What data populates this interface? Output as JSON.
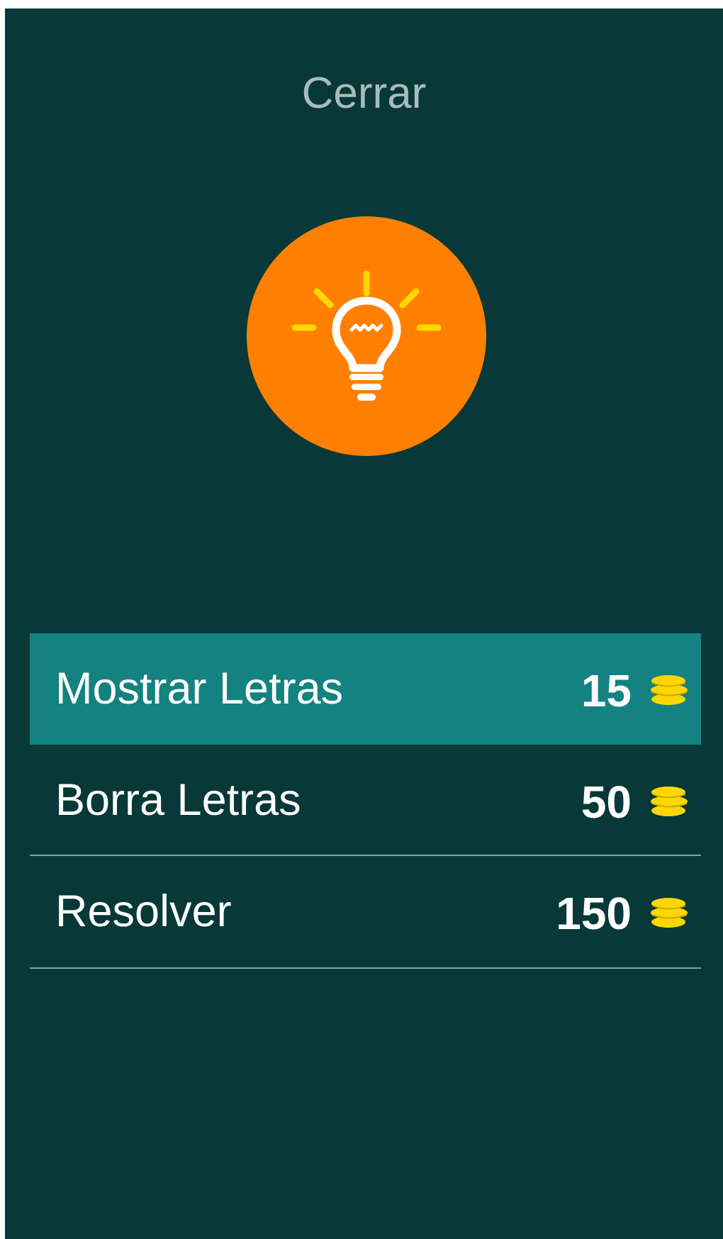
{
  "header": {
    "close_label": "Cerrar"
  },
  "hint": {
    "icon": "lightbulb-icon",
    "circle_color": "#ff8000",
    "ray_color": "#ffd700"
  },
  "options": [
    {
      "label": "Mostrar Letras",
      "price": "15",
      "selected": true
    },
    {
      "label": "Borra Letras",
      "price": "50",
      "selected": false
    },
    {
      "label": "Resolver",
      "price": "150",
      "selected": false
    }
  ],
  "colors": {
    "background": "#083838",
    "selected_row": "#138281",
    "coin": "#ffd700"
  },
  "coin_icon": "coin-stack-icon"
}
